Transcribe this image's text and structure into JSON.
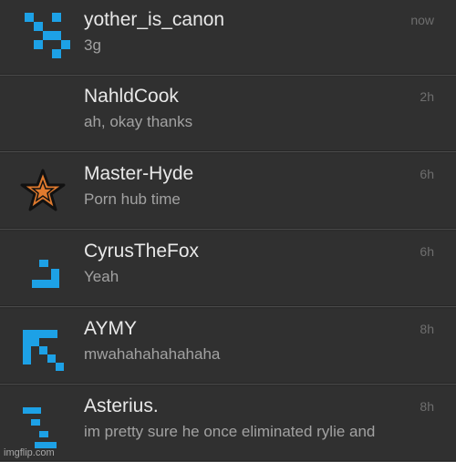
{
  "accent_color": "#1da1e6",
  "conversations": [
    {
      "name": "yother_is_canon",
      "message": "3g",
      "time": "now",
      "avatar_icon": "pixel-x-icon"
    },
    {
      "name": "NahldCook",
      "message": "ah, okay thanks",
      "time": "2h",
      "avatar_icon": ""
    },
    {
      "name": "Master-Hyde",
      "message": "Porn hub time",
      "time": "6h",
      "avatar_icon": "orange-star-icon"
    },
    {
      "name": "CyrusTheFox",
      "message": "Yeah",
      "time": "6h",
      "avatar_icon": "pixel-hook-icon"
    },
    {
      "name": "AYMY",
      "message": "mwahahahahahaha",
      "time": "8h",
      "avatar_icon": "pixel-arrow-icon"
    },
    {
      "name": "Asterius.",
      "message": "im pretty sure he once eliminated rylie and",
      "time": "8h",
      "avatar_icon": "pixel-glyph-icon"
    }
  ],
  "watermark": "imgflip.com"
}
